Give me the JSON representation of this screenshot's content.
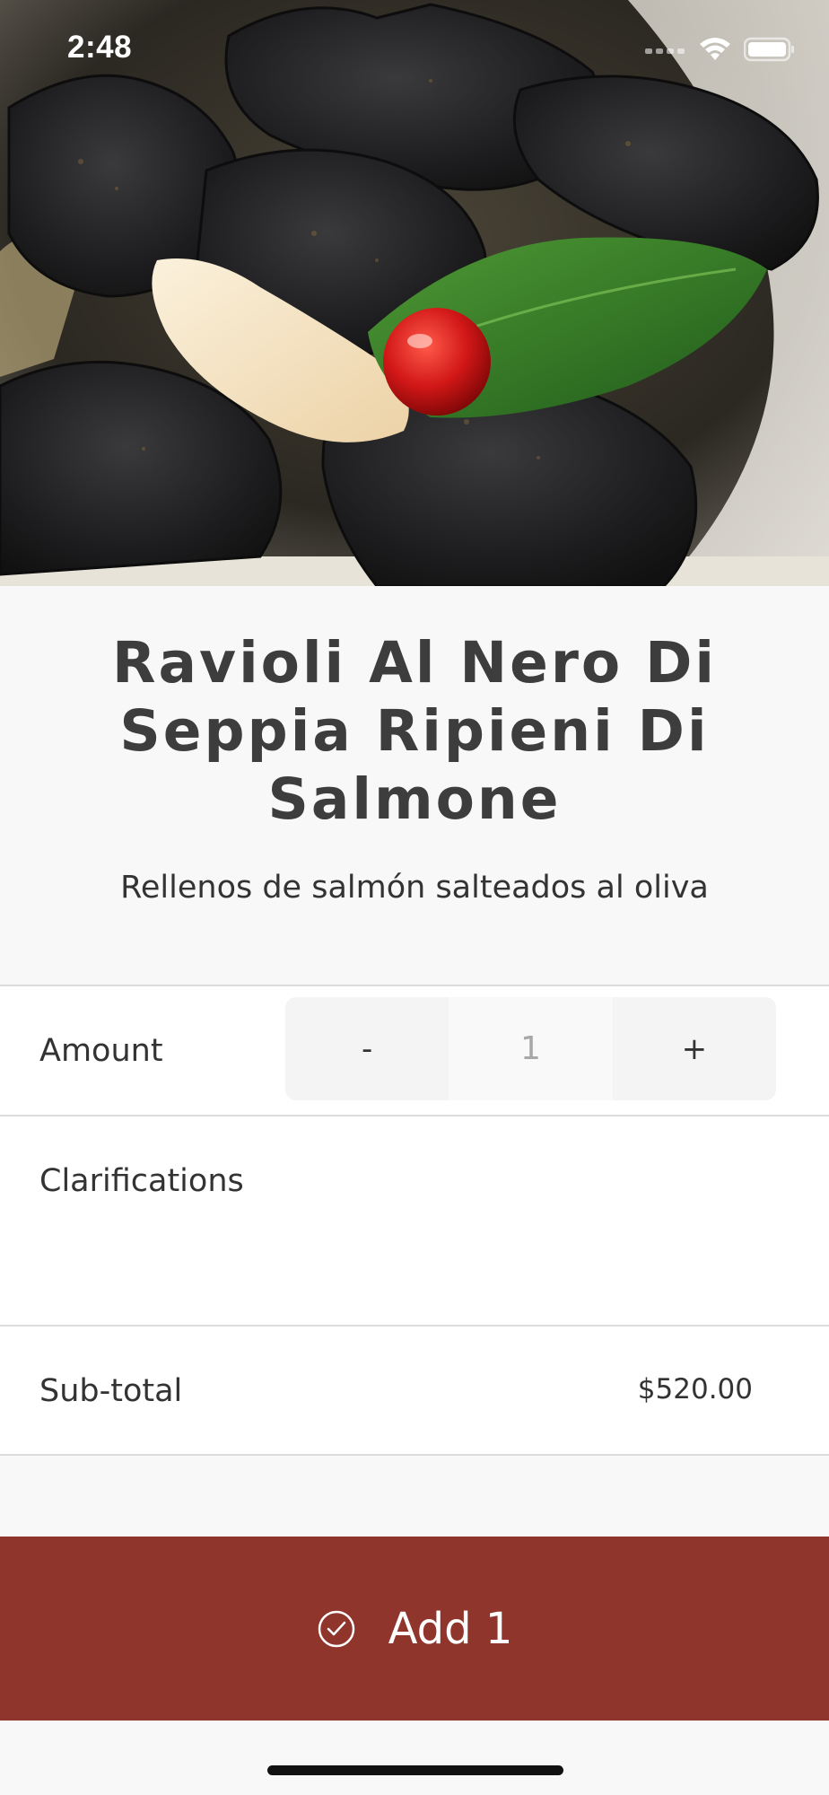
{
  "status_bar": {
    "time": "2:48",
    "icons": [
      "signal-icon",
      "wifi-icon",
      "battery-icon"
    ]
  },
  "hero": {
    "image_subject": "black squid-ink ravioli with salmon cream, basil leaf and cherry tomato"
  },
  "dish": {
    "title": "Ravioli Al Nero Di Seppia Ripieni Di Salmone",
    "subtitle": "Rellenos de salmón salteados al oliva"
  },
  "amount": {
    "label": "Amount",
    "decrement_label": "-",
    "value": "1",
    "increment_label": "+"
  },
  "clarifications": {
    "label": "Clarifications"
  },
  "subtotal": {
    "label": "Sub-total",
    "value": "$520.00"
  },
  "add_button": {
    "label": "Add 1",
    "icon": "check-circle-icon"
  },
  "colors": {
    "accent": "#8f352b",
    "background": "#f8f8f8",
    "row_background": "#ffffff",
    "divider": "#dcdcdc"
  }
}
